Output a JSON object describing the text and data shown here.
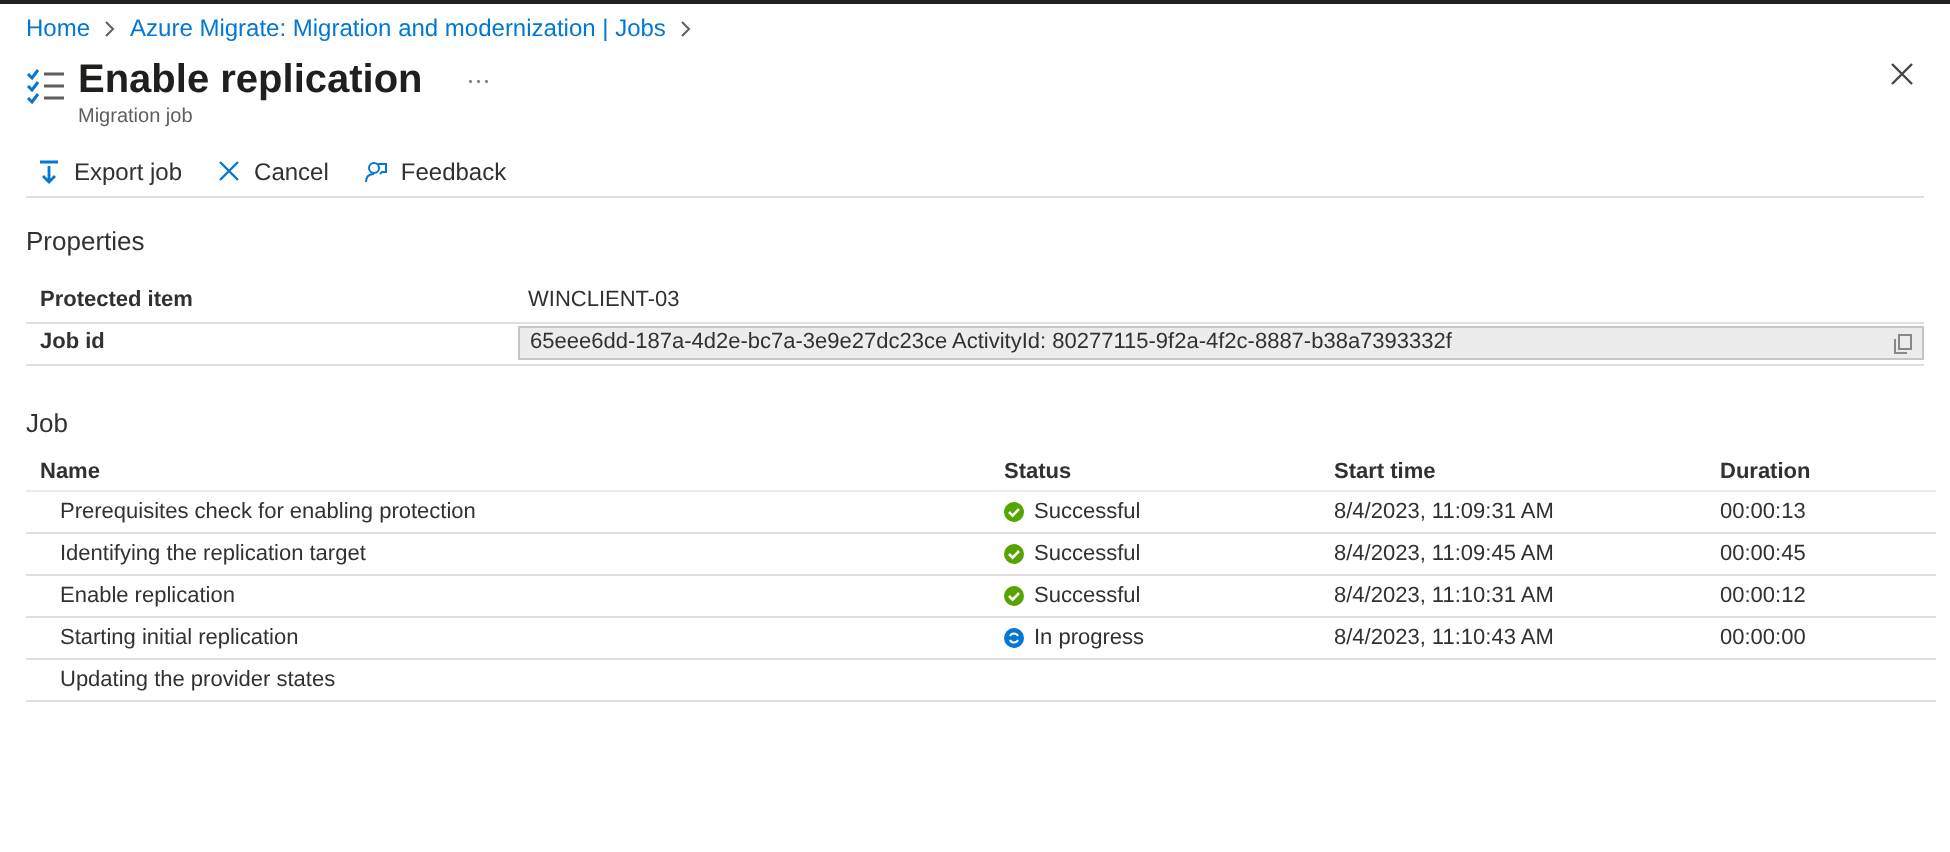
{
  "breadcrumb": [
    "Home",
    "Azure Migrate: Migration and modernization | Jobs"
  ],
  "title": "Enable replication",
  "more": "···",
  "subtitle": "Migration job",
  "toolbar": [
    {
      "kind": "export",
      "label": "Export job"
    },
    {
      "kind": "cancel",
      "label": "Cancel"
    },
    {
      "kind": "feedback",
      "label": "Feedback"
    }
  ],
  "properties": {
    "heading": "Properties",
    "rows": [
      {
        "label": "Protected item",
        "value": "WINCLIENT-03",
        "kind": "text"
      },
      {
        "label": "Job id",
        "value": "65eee6dd-187a-4d2e-bc7a-3e9e27dc23ce ActivityId: 80277115-9f2a-4f2c-8887-b38a7393332f",
        "kind": "copy"
      }
    ]
  },
  "job": {
    "heading": "Job",
    "columns": [
      "Name",
      "Status",
      "Start time",
      "Duration"
    ],
    "rows": [
      {
        "name": "Prerequisites check for enabling protection",
        "status": "Successful",
        "kind": "success",
        "start": "8/4/2023, 11:09:31 AM",
        "duration": "00:00:13"
      },
      {
        "name": "Identifying the replication target",
        "status": "Successful",
        "kind": "success",
        "start": "8/4/2023, 11:09:45 AM",
        "duration": "00:00:45"
      },
      {
        "name": "Enable replication",
        "status": "Successful",
        "kind": "success",
        "start": "8/4/2023, 11:10:31 AM",
        "duration": "00:00:12"
      },
      {
        "name": "Starting initial replication",
        "status": "In progress",
        "kind": "in_progress",
        "start": "8/4/2023, 11:10:43 AM",
        "duration": "00:00:00"
      },
      {
        "name": "Updating the provider states"
      }
    ]
  }
}
